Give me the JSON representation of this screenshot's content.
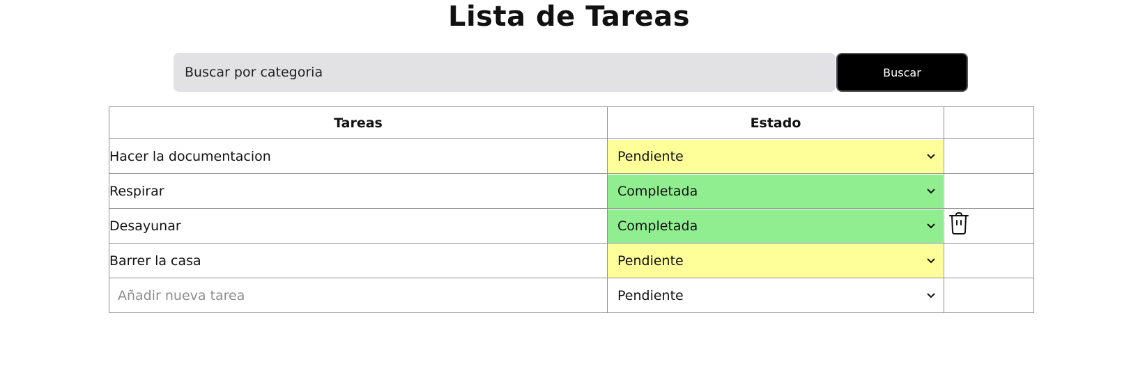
{
  "page": {
    "title": "Lista de Tareas"
  },
  "search": {
    "placeholder": "Buscar por categoria",
    "value": "",
    "button_label": "Buscar"
  },
  "table": {
    "headers": {
      "tasks": "Tareas",
      "state": "Estado",
      "actions": ""
    },
    "rows": [
      {
        "task": "Hacer la documentacion",
        "state": "Pendiente",
        "state_color": "#ffff99"
      },
      {
        "task": "Respirar",
        "state": "Completada",
        "state_color": "#90ee90"
      },
      {
        "task": "Desayunar",
        "state": "Completada",
        "state_color": "#90ee90"
      },
      {
        "task": "Barrer la casa",
        "state": "Pendiente",
        "state_color": "#ffff99"
      }
    ],
    "state_options": [
      "Pendiente",
      "Completada"
    ],
    "new_task": {
      "placeholder": "Añadir nueva tarea",
      "value": "",
      "state": "Pendiente",
      "state_color": "#ffffff"
    },
    "trash_icon": "trash-icon"
  },
  "colors": {
    "pending": "#ffff99",
    "completed": "#90ee90",
    "search_bg": "#e2e1e3",
    "button_bg": "#000000"
  }
}
